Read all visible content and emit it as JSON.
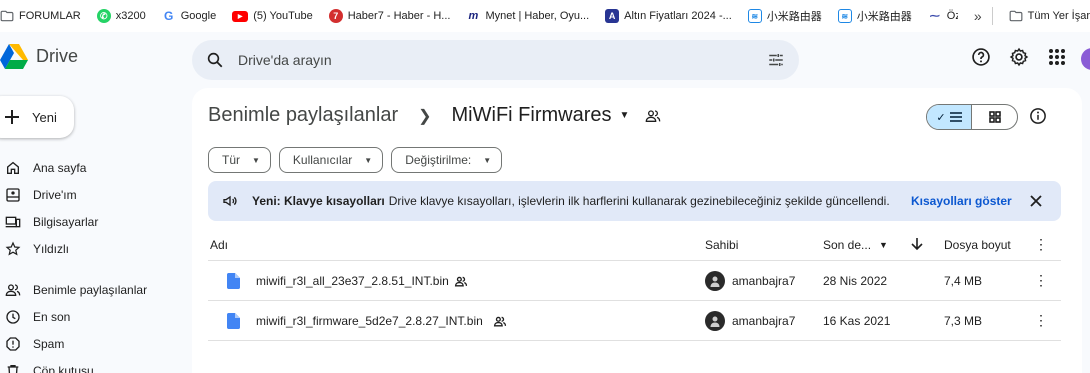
{
  "bookmarks": {
    "items": [
      {
        "label": "FORUMLAR",
        "icon": "folder-icon",
        "color": "#5f6368"
      },
      {
        "label": "x3200",
        "icon": "whatsapp-icon",
        "color": "#25d366"
      },
      {
        "label": "Google",
        "icon": "google-icon",
        "color": "#4285f4"
      },
      {
        "label": "(5) YouTube",
        "icon": "youtube-icon",
        "color": "#ff0000"
      },
      {
        "label": "Haber7 - Haber - H...",
        "icon": "haber7-icon",
        "color": "#d32f2f"
      },
      {
        "label": "Mynet | Haber, Oyu...",
        "icon": "mynet-icon",
        "color": "#1a237e"
      },
      {
        "label": "Altın Fiyatları 2024 -...",
        "icon": "altin-icon",
        "color": "#283593"
      },
      {
        "label": "小米路由器",
        "icon": "wifi-icon",
        "color": "#1e88e5"
      },
      {
        "label": "小米路由器",
        "icon": "wifi-icon",
        "color": "#1e88e5"
      },
      {
        "label": "Özet",
        "icon": "ozet-icon",
        "color": "#3949ab"
      }
    ],
    "overflow": "»",
    "all_bookmarks": "Tüm Yer İşar"
  },
  "header": {
    "app_name": "Drive",
    "search_placeholder": "Drive'da arayın"
  },
  "sidebar": {
    "new_button": "Yeni",
    "items": [
      {
        "label": "Ana sayfa",
        "icon": "home-icon"
      },
      {
        "label": "Drive'ım",
        "icon": "my-drive-icon"
      },
      {
        "label": "Bilgisayarlar",
        "icon": "computers-icon"
      },
      {
        "label": "Yıldızlı",
        "icon": "star-icon"
      },
      {
        "label": "Benimle paylaşılanlar",
        "icon": "shared-people-icon"
      },
      {
        "label": "En son",
        "icon": "clock-icon"
      },
      {
        "label": "Spam",
        "icon": "spam-icon"
      },
      {
        "label": "Çöp kutusu",
        "icon": "trash-icon"
      }
    ]
  },
  "main": {
    "breadcrumb_parent": "Benimle paylaşılanlar",
    "breadcrumb_current": "MiWiFi Firmwares",
    "filters": [
      "Tür",
      "Kullanıcılar",
      "Değiştirilme:"
    ],
    "banner": {
      "title": "Yeni: Klavye kısayolları",
      "text": "Drive klavye kısayolları, işlevlerin ilk harflerini kullanarak gezinebileceğiniz şekilde güncellendi.",
      "link": "Kısayolları göster"
    },
    "columns": {
      "name": "Adı",
      "owner": "Sahibi",
      "date": "Son de...",
      "size": "Dosya boyut"
    },
    "files": [
      {
        "name": "miwifi_r3l_all_23e37_2.8.51_INT.bin",
        "owner": "amanbajra7",
        "date": "28 Nis 2022",
        "size": "7,4 MB"
      },
      {
        "name": "miwifi_r3l_firmware_5d2e7_2.8.27_INT.bin",
        "owner": "amanbajra7",
        "date": "16 Kas 2021",
        "size": "7,3 MB"
      }
    ]
  },
  "colors": {
    "accent": "#0b57d0",
    "banner_bg": "#e1e9f8",
    "toggle_active": "#c2e7ff",
    "search_bg": "#e9eef6"
  }
}
